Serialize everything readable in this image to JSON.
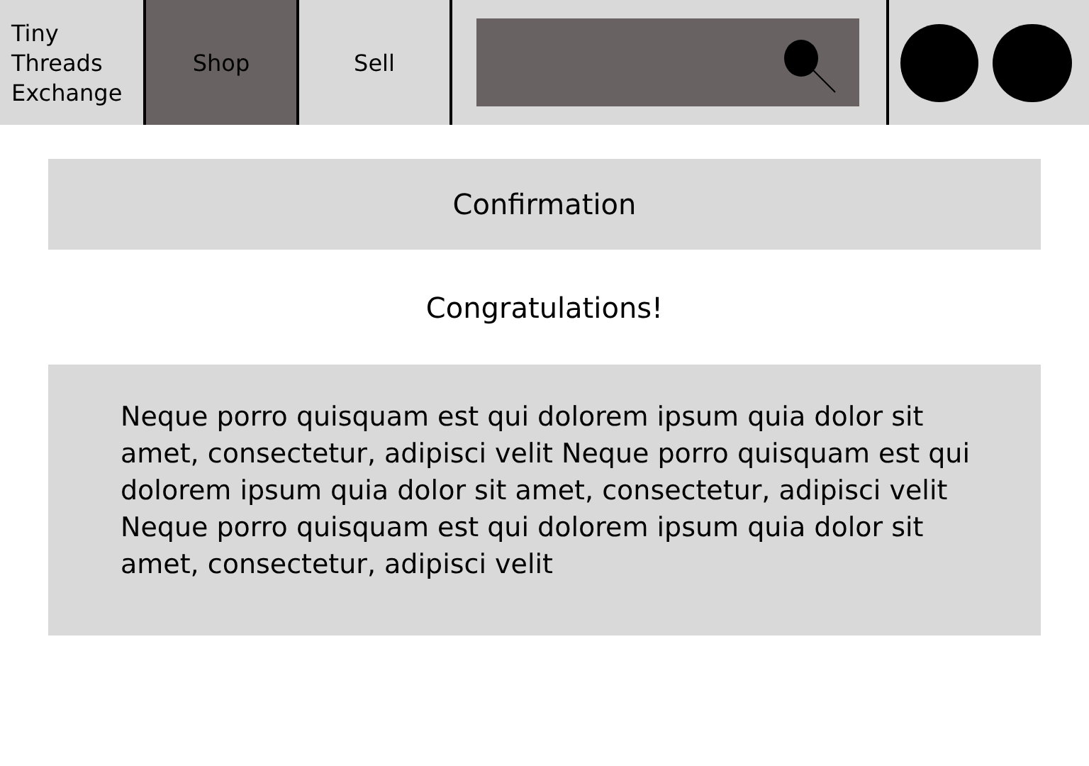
{
  "logo": "Tiny Threads Exchange",
  "tabs": [
    {
      "label": "Shop",
      "selected": true
    },
    {
      "label": "Sell",
      "selected": false
    }
  ],
  "heading": "Confirmation",
  "message": "Congratulations!",
  "body": "Neque porro quisquam est qui dolorem ipsum quia dolor sit amet, consectetur, adipisci velit Neque porro quisquam est qui dolorem ipsum quia dolor sit amet, consectetur, adipisci velit Neque porro quisquam est qui dolorem ipsum quia dolor sit amet, consectetur, adipisci velit"
}
